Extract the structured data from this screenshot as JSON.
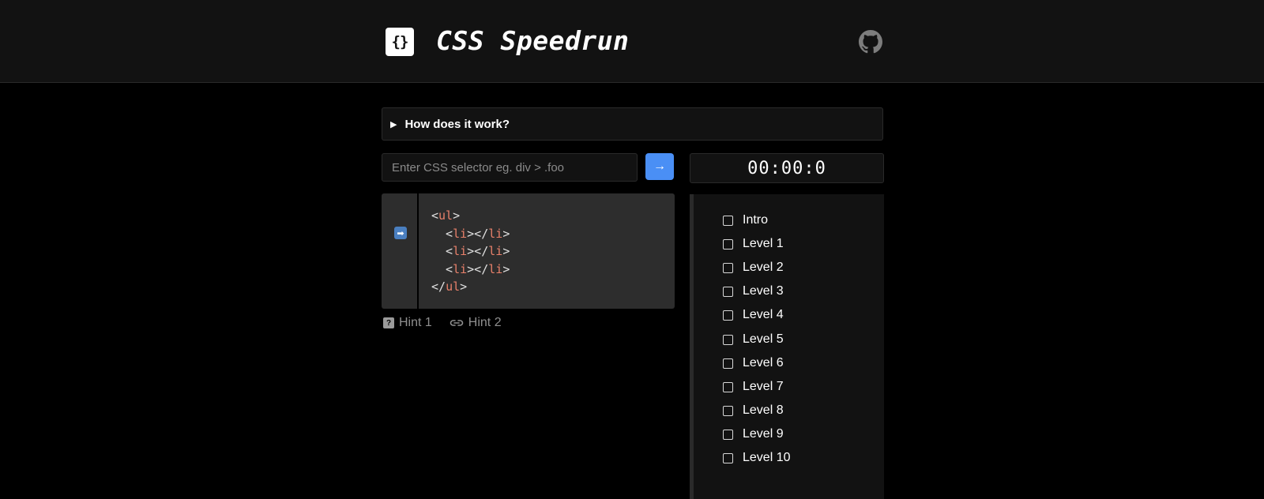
{
  "header": {
    "logo_text": "{}",
    "title": "CSS Speedrun"
  },
  "faq": {
    "label": "How does it work?"
  },
  "search": {
    "placeholder": "Enter CSS selector eg. div > .foo",
    "submit_icon": "arrow-right-icon",
    "submit_label": "→"
  },
  "timer": {
    "value": "00:00:0"
  },
  "code": {
    "lines": [
      {
        "pre": "<",
        "tag": "ul",
        "post": ">"
      },
      {
        "pre": "  <",
        "tag": "li",
        "mid": "></",
        "tag2": "li",
        "post": ">"
      },
      {
        "pre": "  <",
        "tag": "li",
        "mid": "></",
        "tag2": "li",
        "post": ">"
      },
      {
        "pre": "  <",
        "tag": "li",
        "mid": "></",
        "tag2": "li",
        "post": ">"
      },
      {
        "pre": "</",
        "tag": "ul",
        "post": ">"
      }
    ],
    "current_marker": "➡"
  },
  "hints": [
    {
      "label": "Hint 1",
      "icon": "question-icon"
    },
    {
      "label": "Hint 2",
      "icon": "link-icon"
    }
  ],
  "levels": [
    "Intro",
    "Level 1",
    "Level 2",
    "Level 3",
    "Level 4",
    "Level 5",
    "Level 6",
    "Level 7",
    "Level 8",
    "Level 9",
    "Level 10"
  ],
  "colors": {
    "accent": "#4a8ff5",
    "tag": "#e8806a",
    "bg": "#000000",
    "panel": "#121212"
  }
}
